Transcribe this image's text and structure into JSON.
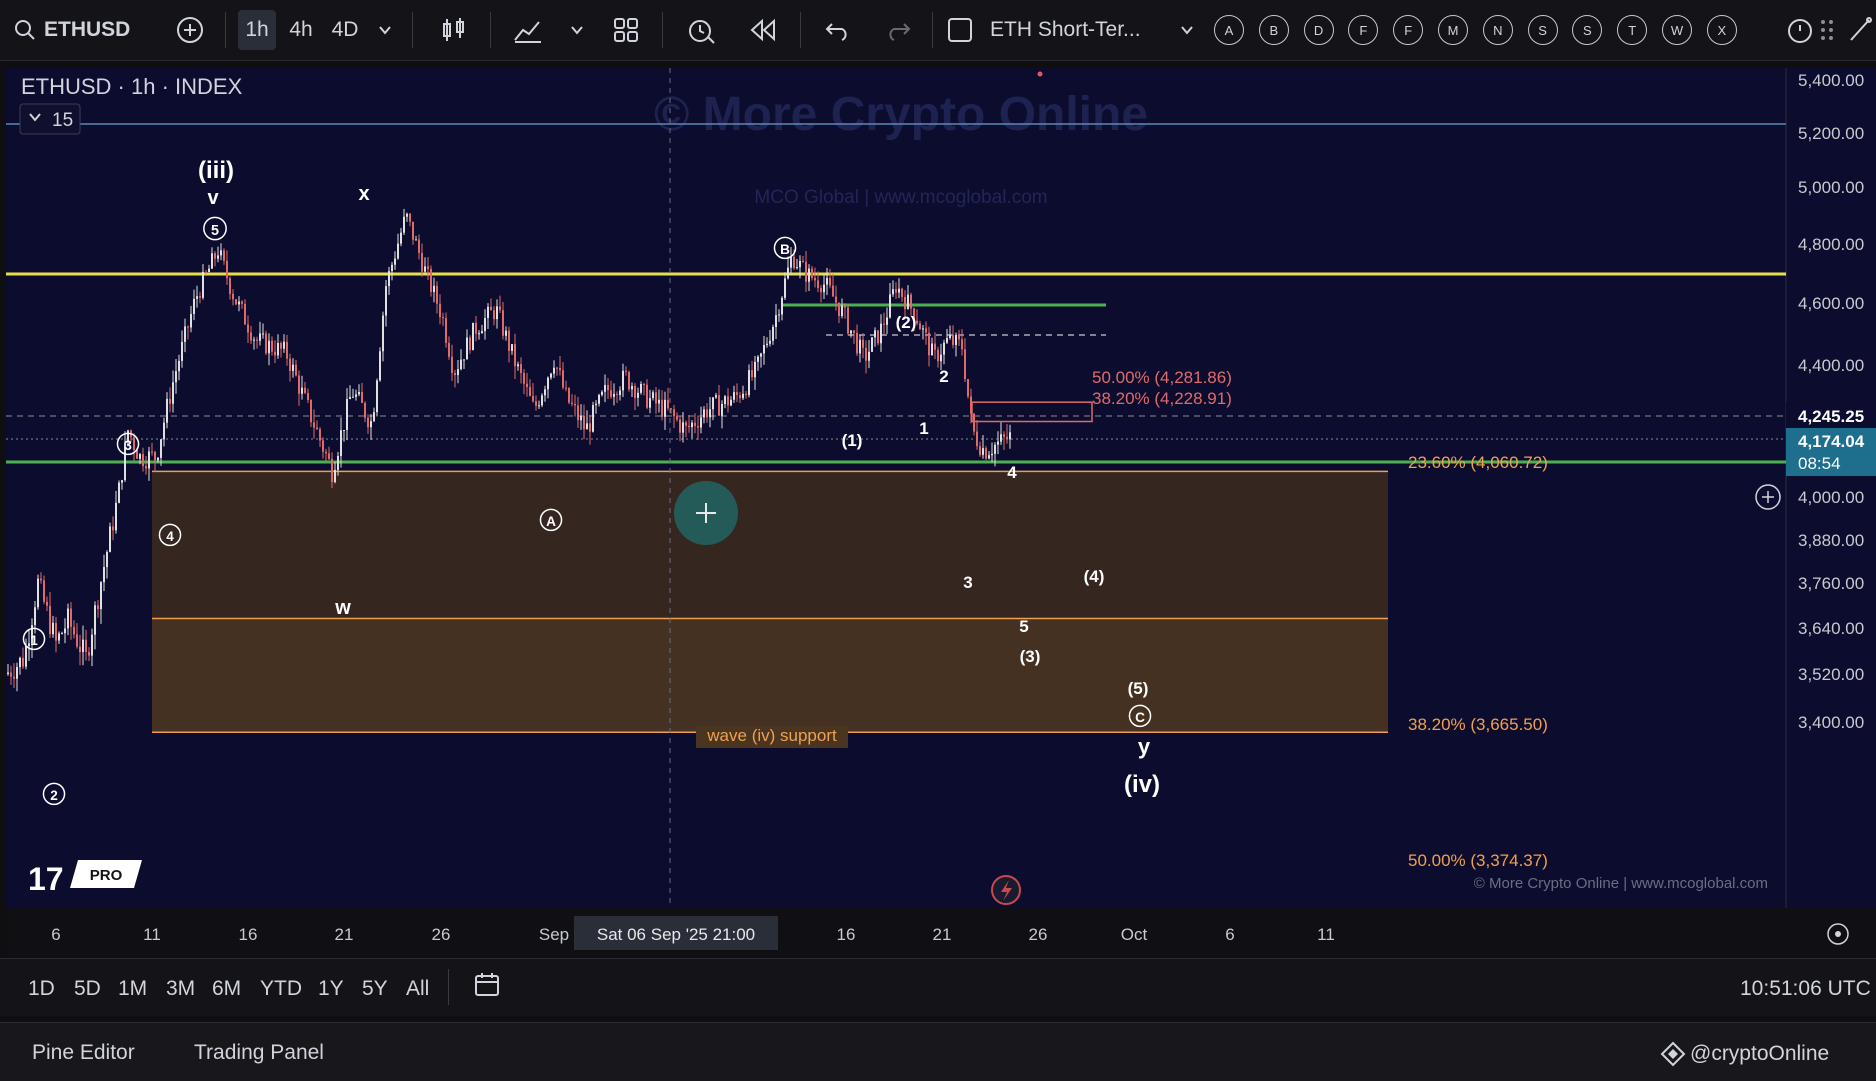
{
  "toolbar": {
    "symbol": "ETHUSD",
    "intervals": [
      "1h",
      "4h",
      "4D"
    ],
    "active_interval": "1h",
    "layout_name": "ETH Short-Ter...",
    "letter_buttons": [
      "A",
      "B",
      "D",
      "F",
      "F",
      "M",
      "N",
      "S",
      "S",
      "T",
      "W",
      "X"
    ]
  },
  "legend": {
    "title": "ETHUSD · 1h · INDEX",
    "indicator_count": "15"
  },
  "watermark": {
    "main": "© More Crypto Online",
    "sub": "MCO Global   |   www.mcoglobal.com",
    "footer": "© More Crypto Online   |   www.mcoglobal.com"
  },
  "colors": {
    "background": "#0c0c2e",
    "yellow_line": "#e8e04a",
    "green_line": "#4caf50",
    "support_zone": "#3a2a1e",
    "support_zone_lower": "#4a3520",
    "fib_orange": "#f0a050",
    "fib_red": "#e06a6a",
    "candle_up": "#e0e0e0",
    "candle_down": "#e06a6a"
  },
  "chart_data": {
    "type": "candlestick",
    "title": "ETHUSD · 1h · INDEX",
    "y_axis": {
      "ticks": [
        5400,
        5200,
        5000,
        4800,
        4600,
        4400,
        4000,
        3880,
        3760,
        3640,
        3520,
        3400
      ],
      "tick_labels": [
        "5,400.00",
        "5,200.00",
        "5,000.00",
        "4,800.00",
        "4,600.00",
        "4,400.00",
        "4,000.00",
        "3,880.00",
        "3,760.00",
        "3,640.00",
        "3,520.00",
        "3,400.00"
      ],
      "price_markers": [
        {
          "value": 4245.25,
          "label": "4,245.25"
        },
        {
          "value": 4174.04,
          "label": "4,174.04",
          "countdown": "08:54"
        }
      ]
    },
    "x_axis": {
      "tick_labels": [
        "6",
        "11",
        "16",
        "21",
        "26",
        "Sep",
        "16",
        "21",
        "26",
        "Oct",
        "6",
        "11"
      ],
      "crosshair_label": "Sat 06 Sep '25   21:00"
    },
    "horizontal_lines": [
      {
        "price": 4860,
        "color": "yellow"
      },
      {
        "price": 4088,
        "color": "green"
      },
      {
        "price": 5245,
        "color": "lightblue"
      }
    ],
    "fib_levels": [
      {
        "label": "50.00% (4,281.86)",
        "value": 4281.86
      },
      {
        "label": "38.20% (4,228.91)",
        "value": 4228.91
      },
      {
        "label": "23.60% (4,060.72)",
        "value": 4060.72
      },
      {
        "label": "38.20% (3,665.50)",
        "value": 3665.5
      },
      {
        "label": "50.00% (3,374.37)",
        "value": 3374.37
      }
    ],
    "zone_label": "wave (iv) support",
    "wave_labels": [
      {
        "text": "(iii)"
      },
      {
        "text": "v"
      },
      {
        "text": "5",
        "circled": true
      },
      {
        "text": "x"
      },
      {
        "text": "w"
      },
      {
        "text": "3",
        "circled": true
      },
      {
        "text": "4",
        "circled": true
      },
      {
        "text": "1",
        "circled": true
      },
      {
        "text": "2",
        "circled": true
      },
      {
        "text": "A",
        "circled": true
      },
      {
        "text": "B",
        "circled": true
      },
      {
        "text": "(2)"
      },
      {
        "text": "(1)"
      },
      {
        "text": "2"
      },
      {
        "text": "1"
      },
      {
        "text": "4"
      },
      {
        "text": "3"
      },
      {
        "text": "(4)"
      },
      {
        "text": "5"
      },
      {
        "text": "(3)"
      },
      {
        "text": "(5)"
      },
      {
        "text": "C",
        "circled": true
      },
      {
        "text": "y"
      },
      {
        "text": "(iv)"
      }
    ]
  },
  "bottom": {
    "ranges": [
      "1D",
      "5D",
      "1M",
      "3M",
      "6M",
      "YTD",
      "1Y",
      "5Y",
      "All"
    ],
    "clock": "10:51:06 UTC"
  },
  "footer": {
    "tabs": [
      "Pine Editor",
      "Trading Panel"
    ],
    "handle": "@cryptoOnline",
    "logo_badge": "PRO"
  }
}
